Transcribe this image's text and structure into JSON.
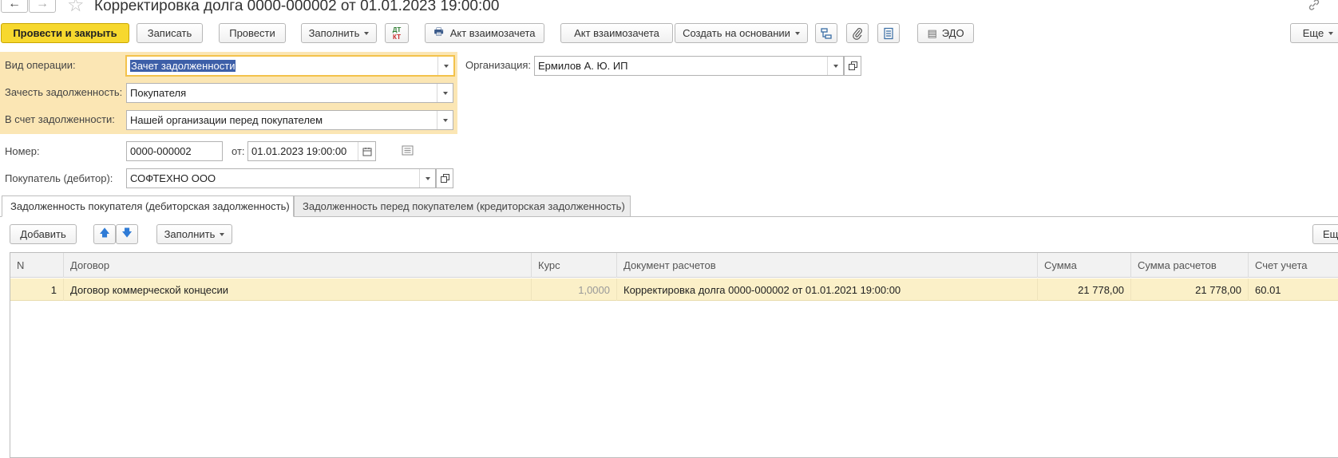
{
  "header": {
    "back_icon": "←",
    "forward_icon": "→",
    "star_icon": "☆",
    "title": "Корректировка долга 0000-000002 от 01.01.2023 19:00:00",
    "link_icon": "🔗"
  },
  "toolbar": {
    "post_close": "Провести и закрыть",
    "save": "Записать",
    "post": "Провести",
    "fill": "Заполнить",
    "dtkt_top": "ДТ",
    "dtkt_bottom": "КТ",
    "print_icon": "🖶",
    "act_print": "Акт взаимозачета",
    "act": "Акт взаимозачета",
    "create_based": "Создать на основании",
    "edo_icon": "▤",
    "edo": "ЭДО",
    "more": "Еще"
  },
  "form": {
    "op_type_label": "Вид операции:",
    "op_type_value": "Зачет задолженности",
    "offset_label": "Зачесть задолженность:",
    "offset_value": "Покупателя",
    "against_label": "В счет задолженности:",
    "against_value": "Нашей организации перед покупателем",
    "org_label": "Организация:",
    "org_value": "Ермилов А. Ю. ИП",
    "number_label": "Номер:",
    "number_value": "0000-000002",
    "date_label": "от:",
    "date_value": "01.01.2023 19:00:00",
    "buyer_label": "Покупатель (дебитор):",
    "buyer_value": "СОФТЕХНО ООО"
  },
  "tabs": [
    {
      "label": "Задолженность покупателя (дебиторская задолженность)"
    },
    {
      "label": "Задолженность перед покупателем (кредиторская задолженность)"
    }
  ],
  "table_toolbar": {
    "add": "Добавить",
    "up_icon": "🡅",
    "down_icon": "🡇",
    "fill": "Заполнить",
    "more": "Еще"
  },
  "table": {
    "columns": [
      "N",
      "Договор",
      "Курс",
      "Документ расчетов",
      "Сумма",
      "Сумма расчетов",
      "Счет учета"
    ],
    "rows": [
      {
        "n": "1",
        "contract": "Договор коммерческой концесии",
        "rate": "1,0000",
        "doc": "Корректировка долга 0000-000002 от 01.01.2021 19:00:00",
        "sum": "21 778,00",
        "sum_calc": "21 778,00",
        "account": "60.01"
      }
    ]
  }
}
